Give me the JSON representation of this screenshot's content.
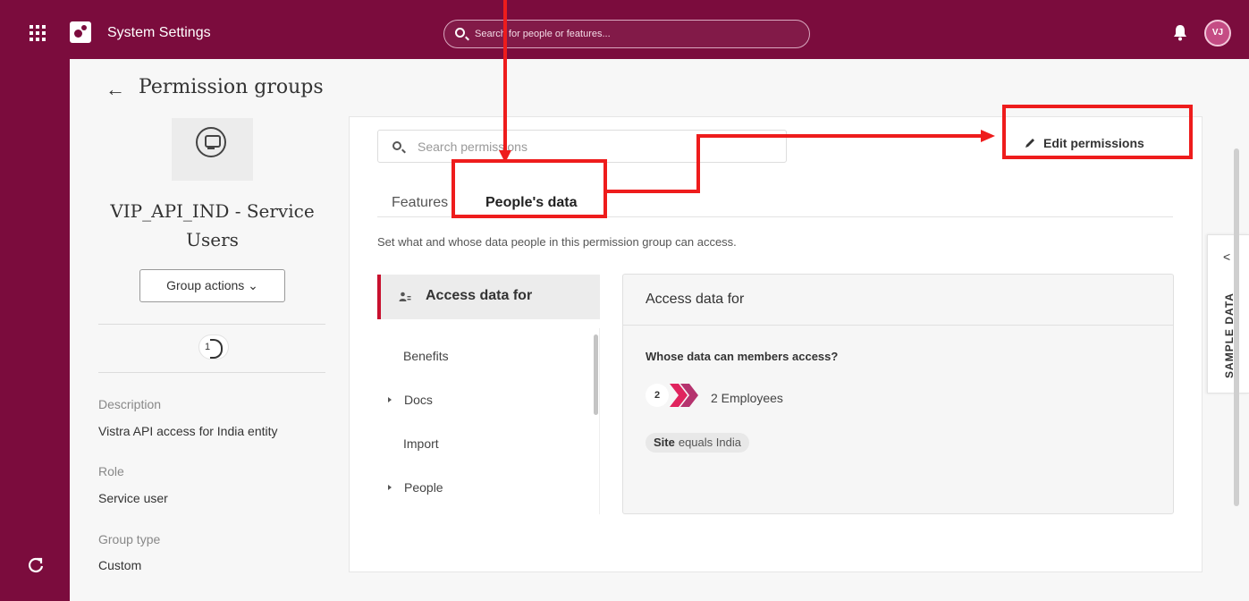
{
  "topbar": {
    "app_title": "System Settings",
    "search_placeholder": "Search for people or features...",
    "avatar_initials": "VJ"
  },
  "page": {
    "back_label": "←",
    "title": "Permission groups"
  },
  "group": {
    "name": "VIP_API_IND - Service Users",
    "actions_label": "Group actions ⌄",
    "member_count": "1",
    "description_label": "Description",
    "description_value": "Vistra API access for India entity",
    "role_label": "Role",
    "role_value": "Service user",
    "type_label": "Group type",
    "type_value": "Custom"
  },
  "permissions": {
    "search_placeholder": "Search permissions",
    "edit_label": "Edit permissions",
    "tabs": [
      {
        "label": "Features",
        "active": false
      },
      {
        "label": "People's data",
        "active": true
      }
    ],
    "description": "Set what and whose data people in this permission group can access.",
    "active_menu": "Access data for",
    "menu_items": [
      {
        "label": "Benefits",
        "expandable": false
      },
      {
        "label": "Docs",
        "expandable": true
      },
      {
        "label": "Import",
        "expandable": false
      },
      {
        "label": "People",
        "expandable": true
      }
    ]
  },
  "detail": {
    "title": "Access data for",
    "question": "Whose data can members access?",
    "employee_count": "2",
    "employee_label": "2 Employees",
    "condition_field": "Site",
    "condition_rest": "equals India"
  },
  "side_tab": {
    "label": "SAMPLE DATA",
    "chevron": "<"
  },
  "colors": {
    "brand": "#7b0c3d",
    "annotation": "#ee1c1c",
    "active_accent": "#c8102e"
  }
}
